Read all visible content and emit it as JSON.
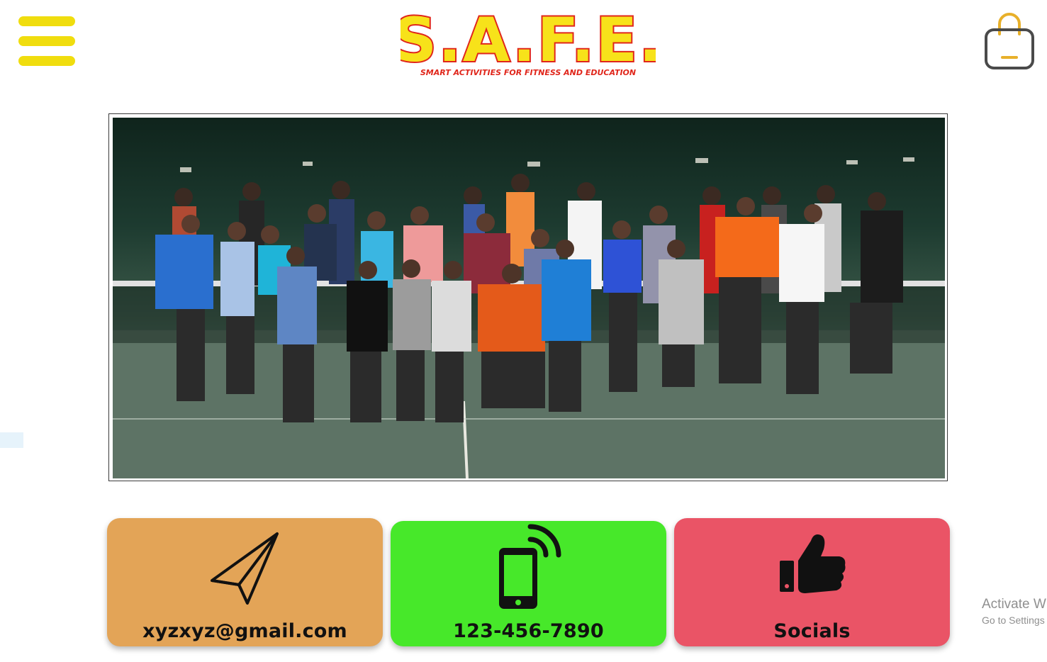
{
  "header": {
    "menu_icon": "hamburger-menu-icon",
    "logo": {
      "title": "S.A.F.E.",
      "tagline": "SMART ACTIVITIES FOR FITNESS AND EDUCATION",
      "colors": {
        "fill": "#f7e21a",
        "outline": "#e0261b",
        "tagline": "#e0261b"
      }
    },
    "cart_icon": "shopping-bag-icon",
    "cart_color": "#e8b02a"
  },
  "hero_photo": {
    "description_icon": "group-photo-image"
  },
  "contact_cards": [
    {
      "icon": "paper-plane-icon",
      "label": "xyzxyz@gmail.com",
      "color": "#e3a457"
    },
    {
      "icon": "mobile-phone-signal-icon",
      "label": "123-456-7890",
      "color": "#47e82a"
    },
    {
      "icon": "thumbs-up-icon",
      "label": "Socials",
      "color": "#ea5466"
    }
  ],
  "watermark": {
    "line1": "Activate W",
    "line2": "Go to Settings"
  }
}
